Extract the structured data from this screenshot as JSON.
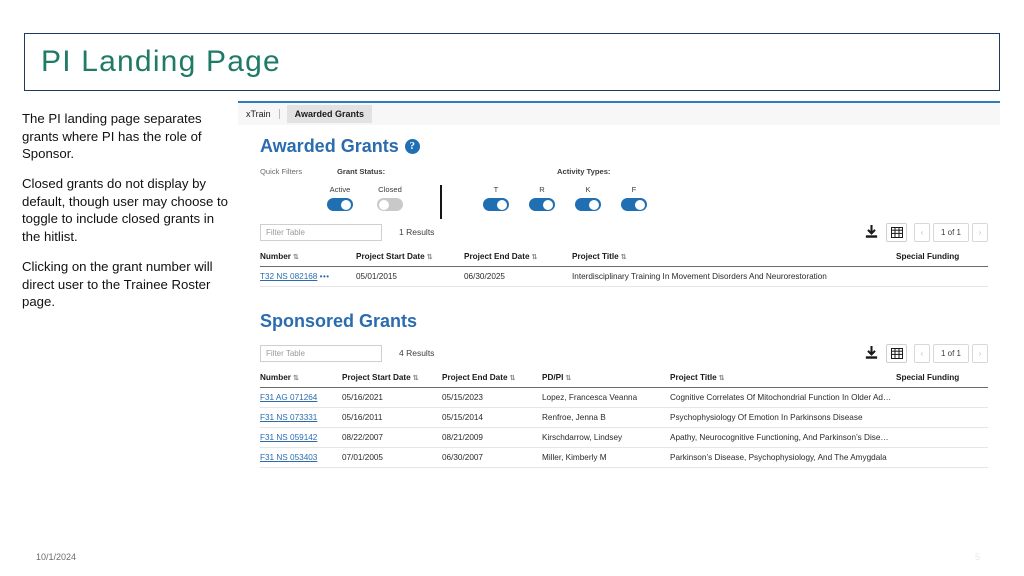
{
  "slide": {
    "title": "PI Landing Page",
    "title_color": "#1f7a66",
    "border_color": "#1f3864",
    "footer_date": "10/1/2024",
    "slide_number": "5"
  },
  "notes": [
    "The PI landing page separates grants where PI has the role of Sponsor.",
    "Closed grants do not display by default, though user may choose to toggle to include closed grants in the hitlist.",
    "Clicking on the grant number will direct user to the Trainee Roster page."
  ],
  "app": {
    "accent_color": "#2b6cb0",
    "breadcrumb": {
      "root": "xTrain",
      "current": "Awarded Grants"
    },
    "awarded": {
      "heading": "Awarded Grants",
      "help_icon": "question-mark-circle-icon",
      "filters": {
        "quick_filters_label": "Quick Filters",
        "grant_status_label": "Grant Status:",
        "activity_types_label": "Activity Types:",
        "status_toggles": [
          {
            "label": "Active",
            "on": true
          },
          {
            "label": "Closed",
            "on": false
          }
        ],
        "activity_toggles": [
          {
            "label": "T",
            "on": true
          },
          {
            "label": "R",
            "on": true
          },
          {
            "label": "K",
            "on": true
          },
          {
            "label": "F",
            "on": true
          }
        ]
      },
      "toolbar": {
        "filter_placeholder": "Filter Table",
        "results": "1 Results",
        "download_icon": "download-icon",
        "grid_icon": "grid-view-icon",
        "prev_icon": "‹",
        "next_icon": "›",
        "page_indicator": "1 of 1"
      },
      "columns": [
        "Number",
        "Project Start Date",
        "Project End Date",
        "Project Title",
        "Special Funding"
      ],
      "rows": [
        {
          "number": "T32 NS 082168",
          "menu": "•••",
          "start": "05/01/2015",
          "end": "06/30/2025",
          "title": "Interdisciplinary Training In Movement Disorders And Neurorestoration",
          "special": ""
        }
      ]
    },
    "sponsored": {
      "heading": "Sponsored Grants",
      "toolbar": {
        "filter_placeholder": "Filter Table",
        "results": "4 Results",
        "download_icon": "download-icon",
        "grid_icon": "grid-view-icon",
        "prev_icon": "‹",
        "next_icon": "›",
        "page_indicator": "1 of 1"
      },
      "columns": [
        "Number",
        "Project Start Date",
        "Project End Date",
        "PD/PI",
        "Project Title",
        "Special Funding"
      ],
      "rows": [
        {
          "number": "F31 AG 071264",
          "start": "05/16/2021",
          "end": "05/15/2023",
          "pdpi": "Lopez, Francesca Veanna",
          "title": "Cognitive Correlates Of Mitochondrial Function In Older Adults",
          "special": ""
        },
        {
          "number": "F31 NS 073331",
          "start": "05/16/2011",
          "end": "05/15/2014",
          "pdpi": "Renfroe, Jenna B",
          "title": "Psychophysiology Of Emotion In Parkinsons Disease",
          "special": ""
        },
        {
          "number": "F31 NS 059142",
          "start": "08/22/2007",
          "end": "08/21/2009",
          "pdpi": "Kirschdarrow, Lindsey",
          "title": "Apathy, Neurocognitive Functioning, And Parkinson’s Disease",
          "special": ""
        },
        {
          "number": "F31 NS 053403",
          "start": "07/01/2005",
          "end": "06/30/2007",
          "pdpi": "Miller, Kimberly M",
          "title": "Parkinson’s Disease, Psychophysiology, And The Amygdala",
          "special": ""
        }
      ]
    }
  }
}
